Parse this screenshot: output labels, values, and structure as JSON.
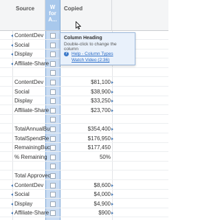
{
  "header": {
    "source_label": "Source",
    "w_label_lines": [
      "W",
      "for",
      "A..."
    ],
    "copied_label": "Copied"
  },
  "tooltip": {
    "title": "Column Heading",
    "body": "Double-click to change the column",
    "help_icon": "?",
    "link1": "Help - Column Types",
    "link2": "Watch Video (2:36)"
  },
  "rows": [
    {
      "label": "ContentDev",
      "value": "",
      "left_arrow": true,
      "right_arrow": false
    },
    {
      "label": "Social",
      "value": "",
      "left_arrow": true,
      "right_arrow": false
    },
    {
      "label": "Display",
      "value": "",
      "left_arrow": true,
      "right_arrow": false
    },
    {
      "label": "Affiliate-Share",
      "value": "",
      "left_arrow": true,
      "right_arrow": false
    },
    {
      "label": "",
      "value": "",
      "left_arrow": false,
      "right_arrow": false
    },
    {
      "label": "ContentDev",
      "value": "$81,100",
      "left_arrow": false,
      "right_arrow": true
    },
    {
      "label": "Social",
      "value": "$38,900",
      "left_arrow": false,
      "right_arrow": true
    },
    {
      "label": "Display",
      "value": "$33,250",
      "left_arrow": false,
      "right_arrow": true
    },
    {
      "label": "Affiliate-Share",
      "value": "$23,700",
      "left_arrow": false,
      "right_arrow": true
    },
    {
      "label": "",
      "value": "",
      "left_arrow": false,
      "right_arrow": false
    },
    {
      "label": "TotalAnnualBu",
      "value": "$354,400",
      "left_arrow": false,
      "right_arrow": true
    },
    {
      "label": "TotalSpendRe",
      "value": "$176,950",
      "left_arrow": false,
      "right_arrow": true
    },
    {
      "label": "RemainingBuc",
      "value": "$177,450",
      "left_arrow": false,
      "right_arrow": false
    },
    {
      "label": "% Remaining",
      "value": "50%",
      "left_arrow": false,
      "right_arrow": false
    },
    {
      "label": "",
      "value": "",
      "left_arrow": false,
      "right_arrow": false
    },
    {
      "label": "Total Approvec",
      "value": "",
      "left_arrow": false,
      "right_arrow": false
    },
    {
      "label": "ContentDev",
      "value": "$8,600",
      "left_arrow": true,
      "right_arrow": true
    },
    {
      "label": "Social",
      "value": "$4,000",
      "left_arrow": true,
      "right_arrow": true
    },
    {
      "label": "Display",
      "value": "$4,900",
      "left_arrow": true,
      "right_arrow": true
    },
    {
      "label": "Affiliate-Share",
      "value": "$900",
      "left_arrow": true,
      "right_arrow": true
    }
  ],
  "colors": {
    "selected_column": "#c9dcf3",
    "selected_header": "#a8c8ec",
    "link": "#2a6cc7",
    "arrow": "#4a7bb5"
  },
  "icons": {
    "cursor": "pointer-cursor-icon",
    "help": "help-icon",
    "checkbox": "checkbox-icon"
  }
}
